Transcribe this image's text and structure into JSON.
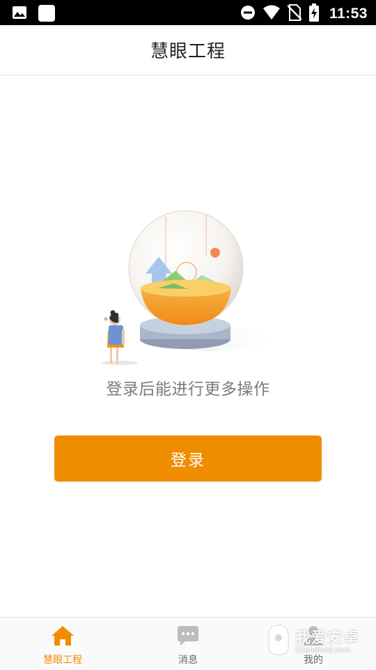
{
  "status_bar": {
    "time": "11:53",
    "left_icons": [
      "image-icon",
      "square-notification-icon"
    ],
    "right_icons": [
      "do-not-disturb-icon",
      "wifi-icon",
      "no-sim-icon",
      "battery-charging-icon"
    ]
  },
  "app_bar": {
    "title": "慧眼工程"
  },
  "empty_state": {
    "message": "登录后能进行更多操作",
    "illustration": "globe-illustration"
  },
  "login_button": {
    "label": "登录"
  },
  "bottom_nav": {
    "items": [
      {
        "label": "慧眼工程",
        "icon": "home-icon",
        "active": true
      },
      {
        "label": "消息",
        "icon": "chat-icon",
        "active": false
      },
      {
        "label": "我的",
        "icon": "person-icon",
        "active": false
      }
    ]
  },
  "colors": {
    "accent": "#f08c00",
    "inactive_icon": "#bdbdbd",
    "text_secondary": "#7b7b7b"
  },
  "watermark": {
    "main": "我爱安卓",
    "sub": "52android.com"
  }
}
